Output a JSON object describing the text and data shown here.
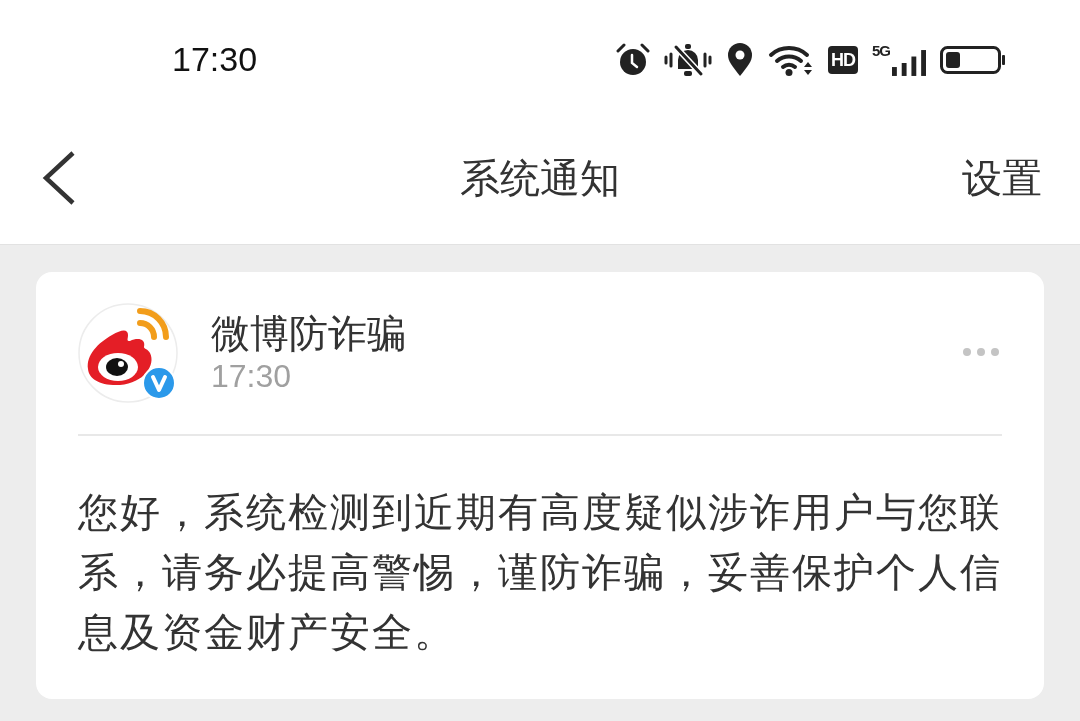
{
  "status_bar": {
    "time": "17:30",
    "hd_label": "HD",
    "network_label": "5G"
  },
  "header": {
    "title": "系统通知",
    "action": "设置"
  },
  "notification": {
    "sender": "微博防诈骗",
    "verified": true,
    "time": "17:30",
    "message": "您好，系统检测到近期有高度疑似涉诈用户与您联系，请务必提高警惕，谨防诈骗，妥善保护个人信息及资金财产安全。"
  }
}
